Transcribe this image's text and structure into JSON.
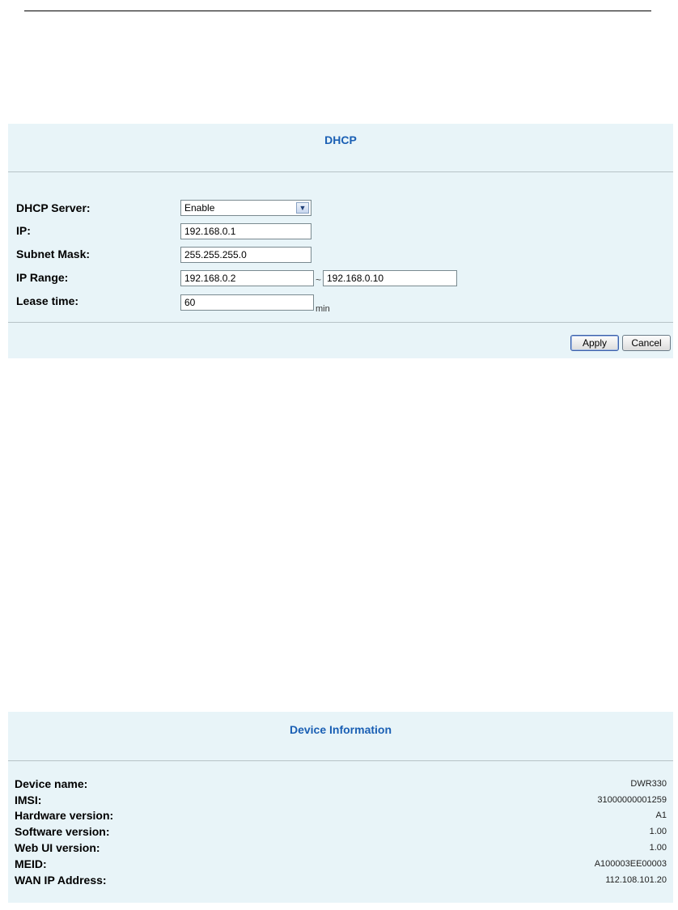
{
  "dhcp": {
    "title": "DHCP",
    "fields": {
      "dhcp_server": {
        "label": "DHCP Server:",
        "value": "Enable"
      },
      "ip": {
        "label": "IP:",
        "value": "192.168.0.1"
      },
      "subnet_mask": {
        "label": "Subnet Mask:",
        "value": "255.255.255.0"
      },
      "ip_range": {
        "label": "IP Range:",
        "start": "192.168.0.2",
        "separator": "~",
        "end": "192.168.0.10"
      },
      "lease_time": {
        "label": "Lease time:",
        "value": "60",
        "unit": "min"
      }
    },
    "buttons": {
      "apply": "Apply",
      "cancel": "Cancel"
    }
  },
  "device_info": {
    "title": "Device Information",
    "rows": [
      {
        "label": "Device name:",
        "value": "DWR330"
      },
      {
        "label": "IMSI:",
        "value": "31000000001259"
      },
      {
        "label": "Hardware version:",
        "value": "A1"
      },
      {
        "label": "Software version:",
        "value": "1.00"
      },
      {
        "label": "Web UI version:",
        "value": "1.00"
      },
      {
        "label": "MEID:",
        "value": "A100003EE00003"
      },
      {
        "label": "WAN IP Address:",
        "value": "112.108.101.20"
      }
    ]
  },
  "colors": {
    "panel_bg": "#e8f4f8",
    "title": "#1a5fb4",
    "rule": "#b7c3c7"
  },
  "icons": {
    "dropdown": "chevron-down-icon"
  }
}
